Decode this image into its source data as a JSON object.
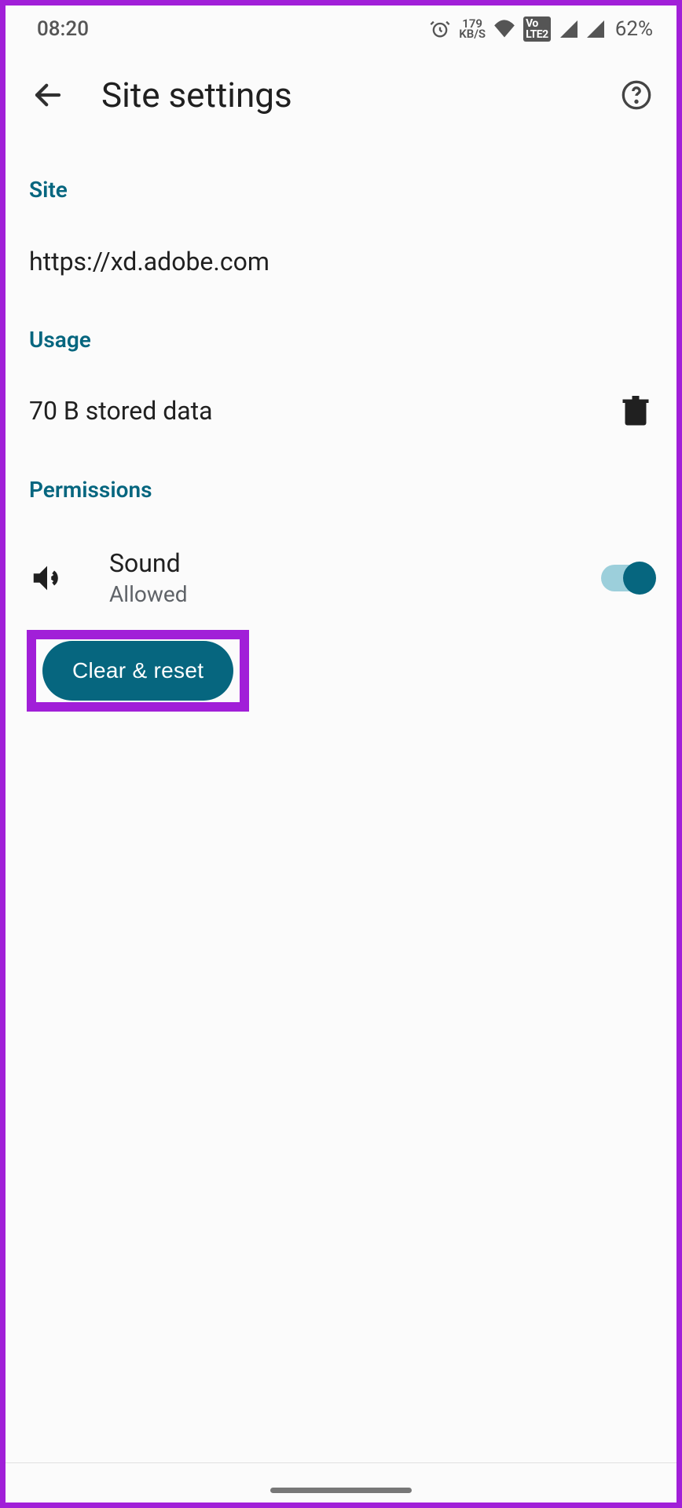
{
  "status": {
    "time": "08:20",
    "net_speed_top": "179",
    "net_speed_bottom": "KB/S",
    "volte_label": "VoLTE2",
    "battery": "62%"
  },
  "header": {
    "title": "Site settings"
  },
  "sections": {
    "site_label": "Site",
    "site_url": "https://xd.adobe.com",
    "usage_label": "Usage",
    "usage_value": "70 B stored data",
    "permissions_label": "Permissions"
  },
  "permission": {
    "name": "Sound",
    "status": "Allowed",
    "enabled": true
  },
  "buttons": {
    "clear_reset": "Clear & reset"
  },
  "colors": {
    "accent": "#06667f",
    "highlight": "#a11fd8"
  }
}
